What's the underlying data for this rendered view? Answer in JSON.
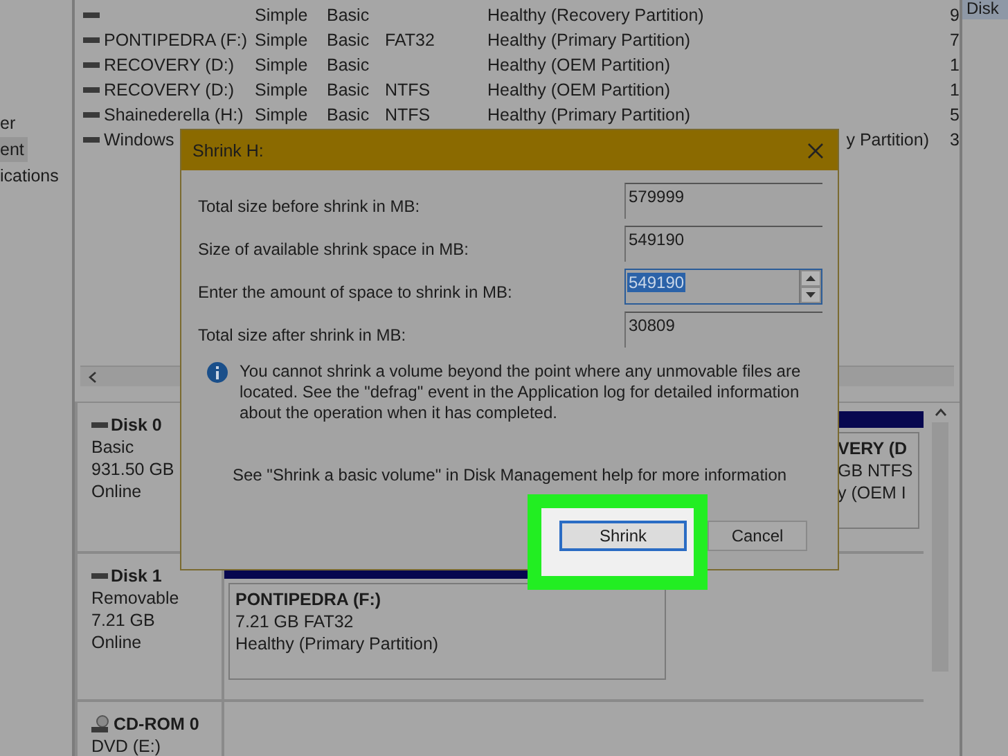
{
  "navigation": {
    "items": [
      {
        "label": "er",
        "selected": false
      },
      {
        "label": "ent",
        "selected": true
      },
      {
        "label": "ications",
        "selected": false
      }
    ]
  },
  "volume_table": {
    "rows": [
      {
        "name": "",
        "layout": "Simple",
        "type": "Basic",
        "file_system": "",
        "status": "Healthy (Recovery Partition)",
        "column_6": "9"
      },
      {
        "name": "PONTIPEDRA (F:)",
        "layout": "Simple",
        "type": "Basic",
        "file_system": "FAT32",
        "status": "Healthy (Primary Partition)",
        "column_6": "7"
      },
      {
        "name": "RECOVERY (D:)",
        "layout": "Simple",
        "type": "Basic",
        "file_system": "",
        "status": "Healthy (OEM Partition)",
        "column_6": "1"
      },
      {
        "name": "RECOVERY (D:)",
        "layout": "Simple",
        "type": "Basic",
        "file_system": "NTFS",
        "status": "Healthy (OEM Partition)",
        "column_6": "1"
      },
      {
        "name": "Shainederella (H:)",
        "layout": "Simple",
        "type": "Basic",
        "file_system": "NTFS",
        "status": "Healthy (Primary Partition)",
        "column_6": "5"
      },
      {
        "name": "Windows",
        "layout": "",
        "type": "",
        "file_system": "",
        "status": "y Partition)",
        "column_6": "3"
      }
    ]
  },
  "disks": [
    {
      "name": "Disk 0",
      "kind": "disk",
      "lines": [
        "Basic",
        "931.50 GB",
        "Online"
      ],
      "partitions": [
        {
          "title": "VERY  (D",
          "lines": [
            "GB NTFS",
            "y (OEM I"
          ]
        }
      ]
    },
    {
      "name": "Disk 1",
      "kind": "disk",
      "lines": [
        "Removable",
        "7.21 GB",
        "Online"
      ],
      "partitions": [
        {
          "title": "PONTIPEDRA  (F:)",
          "lines": [
            "7.21 GB FAT32",
            "Healthy (Primary Partition)"
          ]
        }
      ]
    },
    {
      "name": "CD-ROM 0",
      "kind": "cdrom",
      "lines": [
        "DVD (E:)"
      ]
    }
  ],
  "actions_panel": {
    "header": "Disk"
  },
  "dialog": {
    "title": "Shrink H:",
    "fields": [
      {
        "label": "Total size before shrink in MB:",
        "value": "579999",
        "kind": "readonly",
        "selected": false
      },
      {
        "label": "Size of available shrink space in MB:",
        "value": "549190",
        "kind": "readonly",
        "selected": false
      },
      {
        "label": "Enter the amount of space to shrink in MB:",
        "value": "549190",
        "kind": "spin",
        "selected": true
      },
      {
        "label": "Total size after shrink in MB:",
        "value": "30809",
        "kind": "readonly",
        "selected": false
      }
    ],
    "info": "You cannot shrink a volume beyond the point where any unmovable files are located. See the \"defrag\" event in the Application log for detailed information about the operation when it has completed.",
    "help": "See \"Shrink a basic volume\" in Disk Management help for more information",
    "buttons": [
      {
        "label": "Shrink",
        "highlighted": true
      },
      {
        "label": "Cancel",
        "highlighted": false
      }
    ]
  }
}
